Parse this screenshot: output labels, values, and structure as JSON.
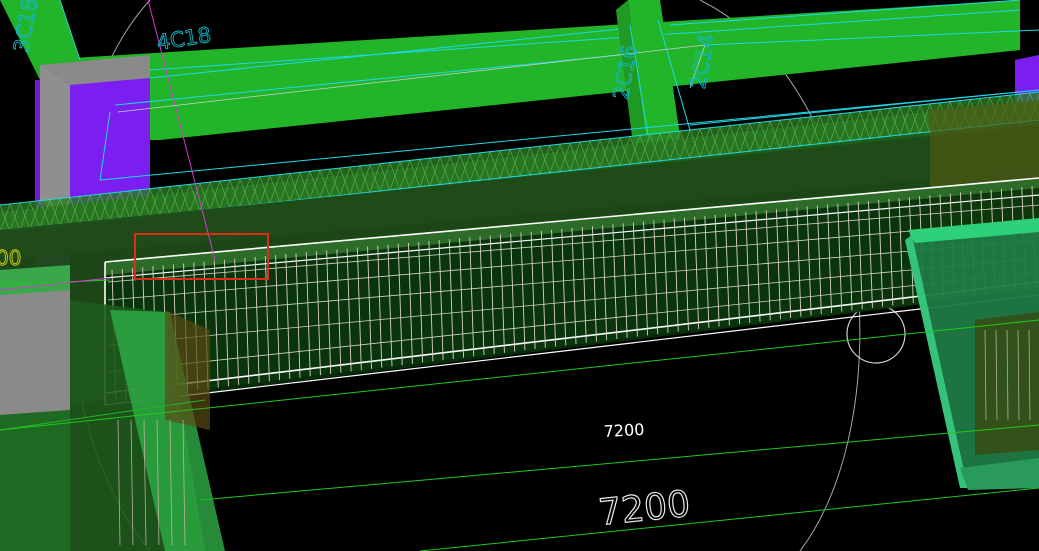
{
  "viewport": {
    "description_label": "",
    "background": "#000000"
  },
  "colors": {
    "beam_green": "#22b52a",
    "dark_green": "#1c5e1a",
    "column_purple": "#7a1ff0",
    "concrete_gray": "#8a8a8a",
    "cyan_line": "#1fd7e6",
    "rebar_white": "#d8d2c8",
    "selection_red": "#e02a1a",
    "axis_magenta": "#d23cd2",
    "teal_slab": "#35c27a"
  },
  "labels": {
    "rebar_top_left": "4C18",
    "rebar_left_edge": "3C18",
    "rebar_mid_1": "2C16",
    "rebar_mid_2": "2C14",
    "left_partial": "00"
  },
  "dimensions": {
    "span_small": "7200",
    "span_large": "7200"
  },
  "selection": {
    "highlight": "selected-rebar-region"
  }
}
